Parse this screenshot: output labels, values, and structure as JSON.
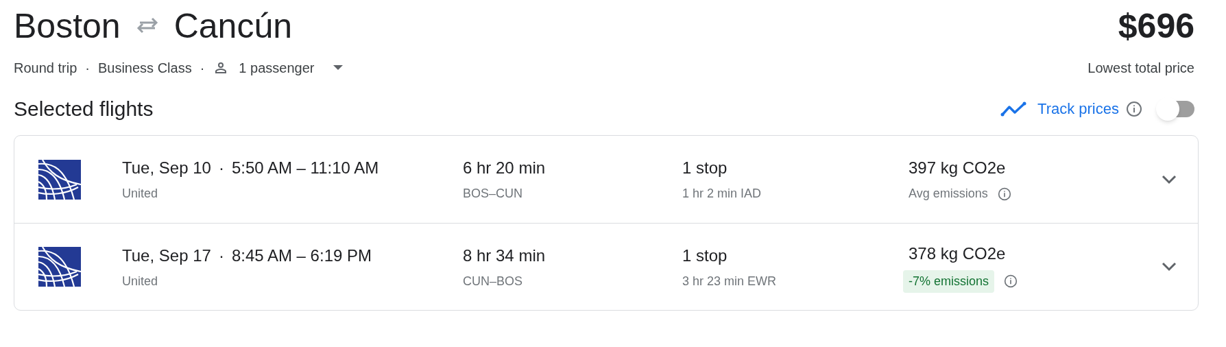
{
  "header": {
    "origin": "Boston",
    "destination": "Cancún",
    "price": "$696",
    "price_label": "Lowest total price"
  },
  "options": {
    "trip": "Round trip",
    "separator_1": "·",
    "cabin": "Business Class",
    "separator_2": "·",
    "passengers": "1 passenger"
  },
  "selected_flights": {
    "title": "Selected flights",
    "track_prices": {
      "label": "Track prices",
      "on": false
    },
    "flights": [
      {
        "date": "Tue, Sep 10",
        "separator": "·",
        "times": "5:50 AM – 11:10 AM",
        "airline": "United",
        "duration": "6 hr 20 min",
        "route": "BOS–CUN",
        "stops": "1 stop",
        "layover": "1 hr 2 min IAD",
        "emissions": "397 kg CO2e",
        "emissions_note": {
          "text": "Avg emissions",
          "kind": "plain"
        },
        "expanded": false
      },
      {
        "date": "Tue, Sep 17",
        "separator": "·",
        "times": "8:45 AM – 6:19 PM",
        "airline": "United",
        "duration": "8 hr 34 min",
        "route": "CUN–BOS",
        "stops": "1 stop",
        "layover": "3 hr 23 min EWR",
        "emissions": "378 kg CO2e",
        "emissions_note": {
          "text": "-7% emissions",
          "kind": "badge"
        },
        "expanded": false
      }
    ]
  }
}
